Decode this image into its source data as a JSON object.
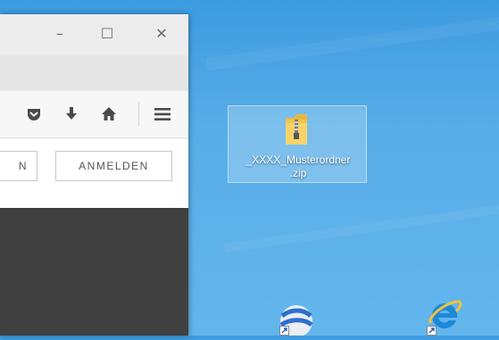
{
  "window": {
    "caption": {
      "minimize": "–",
      "maximize": "☐",
      "close": "✕"
    },
    "buttons": {
      "partial_left": "N",
      "login": "ANMELDEN"
    }
  },
  "desktop": {
    "zip_file": {
      "line1": "_XXXX_Musterordner",
      "line2": ".zip"
    }
  },
  "icons": [
    "pocket-icon",
    "download-icon",
    "home-icon",
    "menu-icon",
    "zip-folder-icon",
    "google-earth-icon",
    "internet-explorer-icon",
    "shortcut-arrow-icon"
  ]
}
